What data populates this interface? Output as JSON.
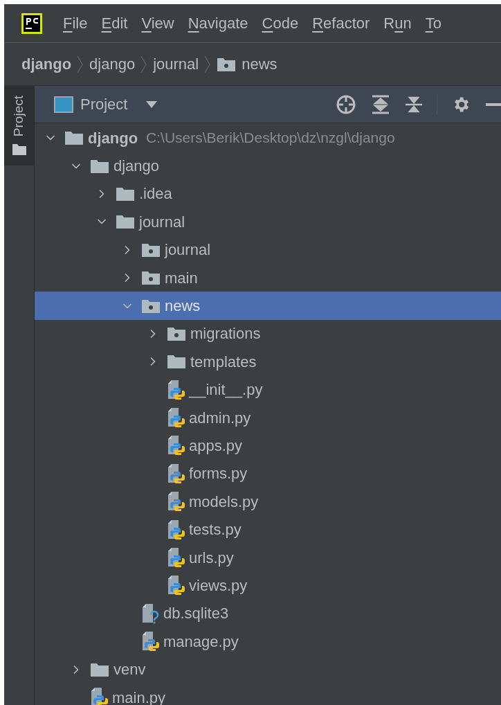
{
  "menu_bar": {
    "items": [
      {
        "key": "F",
        "after": "ile"
      },
      {
        "key": "E",
        "after": "dit"
      },
      {
        "key": "V",
        "after": "iew"
      },
      {
        "key": "N",
        "after": "avigate"
      },
      {
        "key": "C",
        "after": "ode"
      },
      {
        "key": "R",
        "after": "efactor"
      },
      {
        "before": "R",
        "key": "u",
        "after": "n"
      },
      {
        "key": "T",
        "after": "o"
      }
    ]
  },
  "breadcrumb": [
    {
      "label": "django",
      "kind": "project"
    },
    {
      "label": "django",
      "kind": "folder"
    },
    {
      "label": "journal",
      "kind": "folder"
    },
    {
      "label": "news",
      "kind": "package"
    }
  ],
  "tool_stripe": {
    "tabs": [
      {
        "label": "Project",
        "selected": true
      }
    ]
  },
  "project_panel": {
    "view_selector": "Project",
    "tree": [
      {
        "label": "django",
        "path": "C:\\Users\\Berik\\Desktop\\dz\\nzgl\\django",
        "kind": "project",
        "expanded": true,
        "selected": false,
        "children": [
          {
            "label": "django",
            "kind": "folder",
            "expanded": true,
            "selected": false,
            "children": [
              {
                "label": ".idea",
                "kind": "folder",
                "expanded": false,
                "selected": false
              },
              {
                "label": "journal",
                "kind": "folder",
                "expanded": true,
                "selected": false,
                "children": [
                  {
                    "label": "journal",
                    "kind": "package",
                    "expanded": false,
                    "selected": false
                  },
                  {
                    "label": "main",
                    "kind": "package",
                    "expanded": false,
                    "selected": false
                  },
                  {
                    "label": "news",
                    "kind": "package",
                    "expanded": true,
                    "selected": true,
                    "children": [
                      {
                        "label": "migrations",
                        "kind": "package",
                        "expanded": false,
                        "selected": false
                      },
                      {
                        "label": "templates",
                        "kind": "folder",
                        "expanded": false,
                        "selected": false
                      },
                      {
                        "label": "__init__.py",
                        "kind": "python",
                        "selected": false
                      },
                      {
                        "label": "admin.py",
                        "kind": "python",
                        "selected": false
                      },
                      {
                        "label": "apps.py",
                        "kind": "python",
                        "selected": false
                      },
                      {
                        "label": "forms.py",
                        "kind": "python",
                        "selected": false
                      },
                      {
                        "label": "models.py",
                        "kind": "python",
                        "selected": false
                      },
                      {
                        "label": "tests.py",
                        "kind": "python",
                        "selected": false
                      },
                      {
                        "label": "urls.py",
                        "kind": "python",
                        "selected": false
                      },
                      {
                        "label": "views.py",
                        "kind": "python",
                        "selected": false
                      }
                    ]
                  },
                  {
                    "label": "db.sqlite3",
                    "kind": "unknown",
                    "selected": false
                  },
                  {
                    "label": "manage.py",
                    "kind": "python",
                    "selected": false
                  }
                ]
              }
            ]
          },
          {
            "label": "venv",
            "kind": "folder",
            "expanded": false,
            "selected": false
          },
          {
            "label": "main.py",
            "kind": "python",
            "selected": false
          }
        ]
      }
    ]
  }
}
